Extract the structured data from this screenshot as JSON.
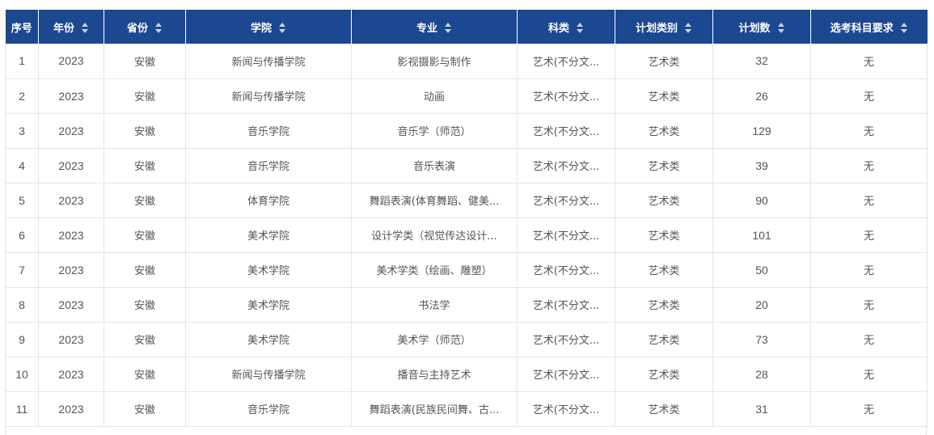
{
  "table": {
    "columns": [
      {
        "label": "序号"
      },
      {
        "label": "年份"
      },
      {
        "label": "省份"
      },
      {
        "label": "学院"
      },
      {
        "label": "专业"
      },
      {
        "label": "科类"
      },
      {
        "label": "计划类别"
      },
      {
        "label": "计划数"
      },
      {
        "label": "选考科目要求"
      }
    ],
    "rows": [
      [
        "1",
        "2023",
        "安徽",
        "新闻与传播学院",
        "影视摄影与制作",
        "艺术(不分文...",
        "艺术类",
        "32",
        "无"
      ],
      [
        "2",
        "2023",
        "安徽",
        "新闻与传播学院",
        "动画",
        "艺术(不分文...",
        "艺术类",
        "26",
        "无"
      ],
      [
        "3",
        "2023",
        "安徽",
        "音乐学院",
        "音乐学（师范）",
        "艺术(不分文...",
        "艺术类",
        "129",
        "无"
      ],
      [
        "4",
        "2023",
        "安徽",
        "音乐学院",
        "音乐表演",
        "艺术(不分文...",
        "艺术类",
        "39",
        "无"
      ],
      [
        "5",
        "2023",
        "安徽",
        "体育学院",
        "舞蹈表演(体育舞蹈、健美...",
        "艺术(不分文...",
        "艺术类",
        "90",
        "无"
      ],
      [
        "6",
        "2023",
        "安徽",
        "美术学院",
        "设计学类（视觉传达设计...",
        "艺术(不分文...",
        "艺术类",
        "101",
        "无"
      ],
      [
        "7",
        "2023",
        "安徽",
        "美术学院",
        "美术学类（绘画、雕塑）",
        "艺术(不分文...",
        "艺术类",
        "50",
        "无"
      ],
      [
        "8",
        "2023",
        "安徽",
        "美术学院",
        "书法学",
        "艺术(不分文...",
        "艺术类",
        "20",
        "无"
      ],
      [
        "9",
        "2023",
        "安徽",
        "美术学院",
        "美术学（师范）",
        "艺术(不分文...",
        "艺术类",
        "73",
        "无"
      ],
      [
        "10",
        "2023",
        "安徽",
        "新闻与传播学院",
        "播音与主持艺术",
        "艺术(不分文...",
        "艺术类",
        "28",
        "无"
      ],
      [
        "11",
        "2023",
        "安徽",
        "音乐学院",
        "舞蹈表演(民族民间舞、古...",
        "艺术(不分文...",
        "艺术类",
        "31",
        "无"
      ]
    ]
  },
  "colors": {
    "header_bg": "#1c4791",
    "header_text": "#ffffff",
    "cell_text": "#555555",
    "border": "#e6e6e6"
  },
  "icons": {
    "sort": "sort-arrows-icon"
  }
}
